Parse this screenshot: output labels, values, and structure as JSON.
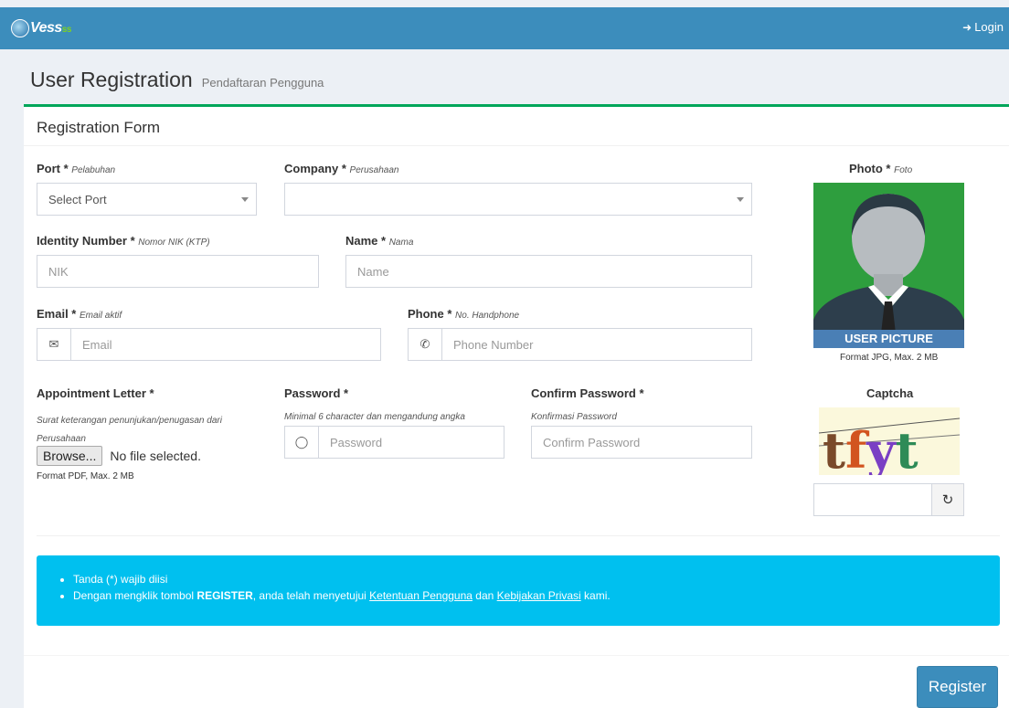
{
  "header": {
    "logo_text": "Vess",
    "logo_suffix": "ss",
    "login_label": "Login"
  },
  "page": {
    "title": "User Registration",
    "subtitle": "Pendaftaran Pengguna"
  },
  "form": {
    "box_title": "Registration Form",
    "port": {
      "label": "Port *",
      "hint": "Pelabuhan",
      "value": "Select Port"
    },
    "company": {
      "label": "Company *",
      "hint": "Perusahaan",
      "value": ""
    },
    "identity": {
      "label": "Identity Number *",
      "hint": "Nomor NIK (KTP)",
      "placeholder": "NIK"
    },
    "name": {
      "label": "Name *",
      "hint": "Nama",
      "placeholder": "Name"
    },
    "email": {
      "label": "Email *",
      "hint": "Email aktif",
      "placeholder": "Email"
    },
    "phone": {
      "label": "Phone *",
      "hint": "No. Handphone",
      "placeholder": "Phone Number"
    },
    "appointment": {
      "label": "Appointment Letter *",
      "desc": "Surat keterangan penunjukan/penugasan dari Perusahaan",
      "browse_label": "Browse...",
      "file_status": "No file selected.",
      "format": "Format PDF, Max. 2 MB"
    },
    "password": {
      "label": "Password *",
      "desc": "Minimal 6 character dan mengandung angka",
      "placeholder": "Password"
    },
    "confirm": {
      "label": "Confirm Password *",
      "desc": "Konfirmasi Password",
      "placeholder": "Confirm Password"
    },
    "photo": {
      "label": "Photo *",
      "hint": "Foto",
      "caption": "USER PICTURE",
      "format": "Format JPG, Max. 2 MB"
    },
    "captcha": {
      "label": "Captcha",
      "text": "tfyt",
      "value": ""
    }
  },
  "info": {
    "line1": "Tanda (*) wajib diisi",
    "line2_prefix": "Dengan mengklik tombol ",
    "line2_bold": "REGISTER",
    "line2_mid": ", anda telah menyetujui ",
    "link_terms": "Ketentuan Pengguna",
    "line2_and": " dan ",
    "link_privacy": "Kebijakan Privasi",
    "line2_suffix": " kami."
  },
  "actions": {
    "register_label": "Register"
  },
  "colors": {
    "topbar": "#3c8dbc",
    "accent_green": "#00a65a",
    "info": "#00c0ef",
    "primary_button": "#3c8dbc"
  }
}
